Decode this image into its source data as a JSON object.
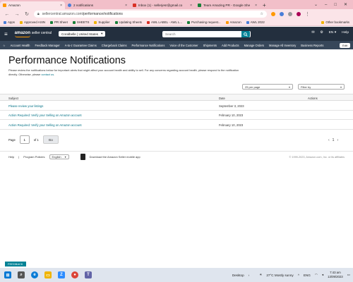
{
  "browser": {
    "tabs": [
      {
        "label": "Amazon",
        "color": "#f90"
      },
      {
        "label": "2 notifications",
        "color": "#4a7ed8"
      },
      {
        "label": "Inbox (1) - sellerjesr@gmail.co",
        "color": "#d93025"
      },
      {
        "label": "Team Amazing PR - Google She",
        "color": "#188038"
      }
    ],
    "new_tab": "+",
    "url_host": "sellercentral.amazon.com",
    "url_path": "/performance/notifications",
    "bookmarks": [
      {
        "label": "Apps",
        "color": "#4a7ed8"
      },
      {
        "label": "Approved ASIN",
        "color": "#f0b400"
      },
      {
        "label": "PR Sheet",
        "color": "#188038"
      },
      {
        "label": "SHEETS",
        "color": "#188038"
      },
      {
        "label": "Supplier",
        "color": "#f0b400"
      },
      {
        "label": "Updating Sheets",
        "color": "#188038"
      },
      {
        "label": "AWL LABEL - AWL L...",
        "color": "#d93025"
      },
      {
        "label": "Purchasing request...",
        "color": "#188038"
      },
      {
        "label": "Amazon",
        "color": "#f90"
      },
      {
        "label": "AWL 2022",
        "color": "#4a7ed8"
      }
    ],
    "other_bookmarks": "Other bookmarks"
  },
  "header": {
    "logo_brand": "amazon",
    "logo_suffix": "seller central",
    "store": "Coralbelle | United States",
    "search_placeholder": "Search",
    "lang": "EN",
    "help": "Help"
  },
  "nav": {
    "items": [
      "Account Health",
      "Feedback Manager",
      "A-to-z Guarantee Claims",
      "Chargeback Claims",
      "Performance Notifications",
      "Voice of the Customer",
      "Shipments",
      "Add Products",
      "Manage Orders",
      "Manage All Inventory",
      "Business Reports"
    ],
    "edit": "Edit"
  },
  "main": {
    "title": "Performance Notifications",
    "description": "Please review the notifications below for important alerts that might affect your account health and ability to sell. For any concerns regarding account health, please respond to the notification directly. Otherwise, please",
    "description_link": "contact us",
    "per_page": "25 per page",
    "filter": "Filter by",
    "columns": {
      "subject": "Subject",
      "date": "Date",
      "actions": "Actions"
    },
    "rows": [
      {
        "subject": "Please review your listings",
        "date": "September 3, 2023"
      },
      {
        "subject": "Action Required: Verify your Selling on Amazon account",
        "date": "February 10, 2023"
      },
      {
        "subject": "Action Required: Verify your Selling on Amazon account",
        "date": "February 10, 2023"
      }
    ],
    "pager": {
      "label": "Page",
      "value": "1",
      "of": "of 1",
      "go": "Go",
      "current": "1"
    }
  },
  "footer": {
    "help": "Help",
    "program_policies": "Program Policies",
    "language": "English",
    "app_text": "Download the Amazon Seller mobile app",
    "copyright": "© 1999-2023, Amazon.com, Inc. or its affiliates"
  },
  "feedback": "FEEDBACK",
  "taskbar": {
    "desktop": "Desktop",
    "weather": "27°C  Mostly sunny",
    "lang": "ENG",
    "time": "7:43 am",
    "date": "13/09/2023"
  }
}
